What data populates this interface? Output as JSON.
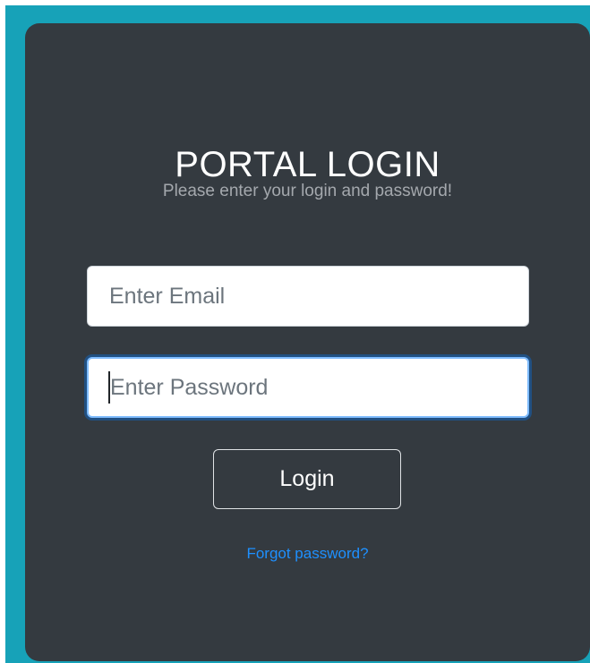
{
  "login": {
    "title": "PORTAL LOGIN",
    "subtitle": "Please enter your login and password!",
    "email": {
      "placeholder": "Enter Email",
      "value": ""
    },
    "password": {
      "placeholder": "Enter Password",
      "value": "",
      "focused": true
    },
    "submit_label": "Login",
    "forgot_label": "Forgot password?"
  },
  "colors": {
    "backdrop": "#17a2b8",
    "card": "#343a40",
    "subtitle": "#a4a8ad",
    "link": "#1e90ff",
    "focus_ring": "#80bdff"
  }
}
